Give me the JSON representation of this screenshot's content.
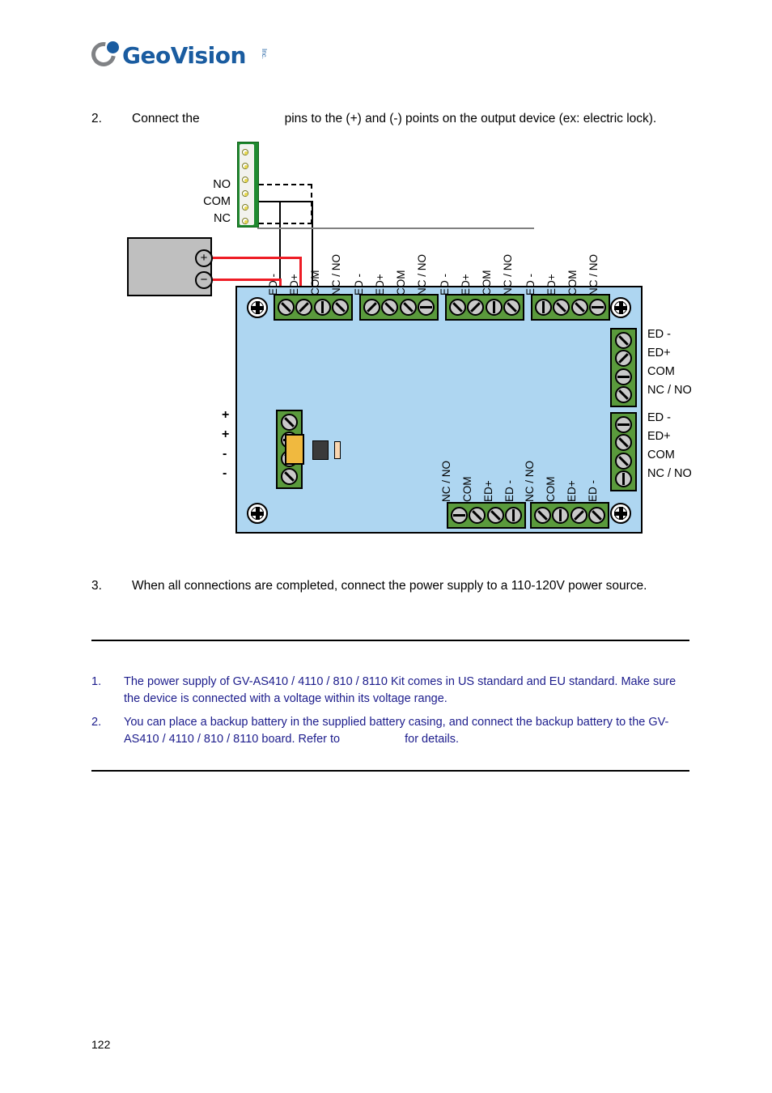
{
  "header": {
    "logo_word": "GeoVision",
    "logo_suffix": "Inc.",
    "logo_color": "#1a5ca0",
    "logo_arc_color": "#808285"
  },
  "steps": [
    {
      "number": "2.",
      "text_before": "Connect the",
      "missing_ref": "",
      "text_after": "pins to the (+) and (-) points on the output device (ex: electric lock)."
    },
    {
      "number": "3.",
      "text": "When all connections are completed, connect the power supply to a 110-120V power source."
    }
  ],
  "notes": [
    {
      "number": "1.",
      "text": "The power supply of GV-AS410 / 4110 / 810 / 8110 Kit comes in US standard and EU standard. Make sure the device is connected with a voltage within its voltage range."
    },
    {
      "number": "2.",
      "text_before": "You can place a backup battery in the supplied battery casing, and connect the backup battery to the GV-AS410 / 4110 / 810 / 8110 board. Refer to",
      "missing_ref": "",
      "text_after": "for details."
    }
  ],
  "note_color": "#1c1c8c",
  "page_number": "122",
  "diagram": {
    "relay_connector": {
      "pin_count": 6,
      "labels": [
        "NO",
        "COM",
        "NC"
      ]
    },
    "output_device": {
      "name": "electric lock",
      "terminals": [
        "+",
        "−"
      ],
      "body_color": "#bfbfbf"
    },
    "pcb": {
      "board_color": "#aed6f1",
      "terminal_color": "#5a9a3c",
      "top_terminals": [
        {
          "labels": [
            "ED -",
            "ED+",
            "COM",
            "NC / NO"
          ]
        },
        {
          "labels": [
            "ED -",
            "ED+",
            "COM",
            "NC / NO"
          ]
        },
        {
          "labels": [
            "ED -",
            "ED+",
            "COM",
            "NC / NO"
          ]
        },
        {
          "labels": [
            "ED -",
            "ED+",
            "COM",
            "NC / NO"
          ]
        }
      ],
      "right_terminals": [
        {
          "labels": [
            "ED -",
            "ED+",
            "COM",
            "NC / NO"
          ]
        },
        {
          "labels": [
            "ED -",
            "ED+",
            "COM",
            "NC / NO"
          ]
        }
      ],
      "bottom_terminals": [
        {
          "labels": [
            "NC / NO",
            "COM",
            "ED+",
            "ED -"
          ]
        },
        {
          "labels": [
            "NC / NO",
            "COM",
            "ED+",
            "ED -"
          ]
        }
      ],
      "power_terminal": {
        "labels": [
          "+",
          "+",
          "-",
          "-"
        ]
      }
    },
    "wire_colors": {
      "power_positive": "#ee1c25",
      "signal": "#000000",
      "reference": "#808080"
    }
  }
}
